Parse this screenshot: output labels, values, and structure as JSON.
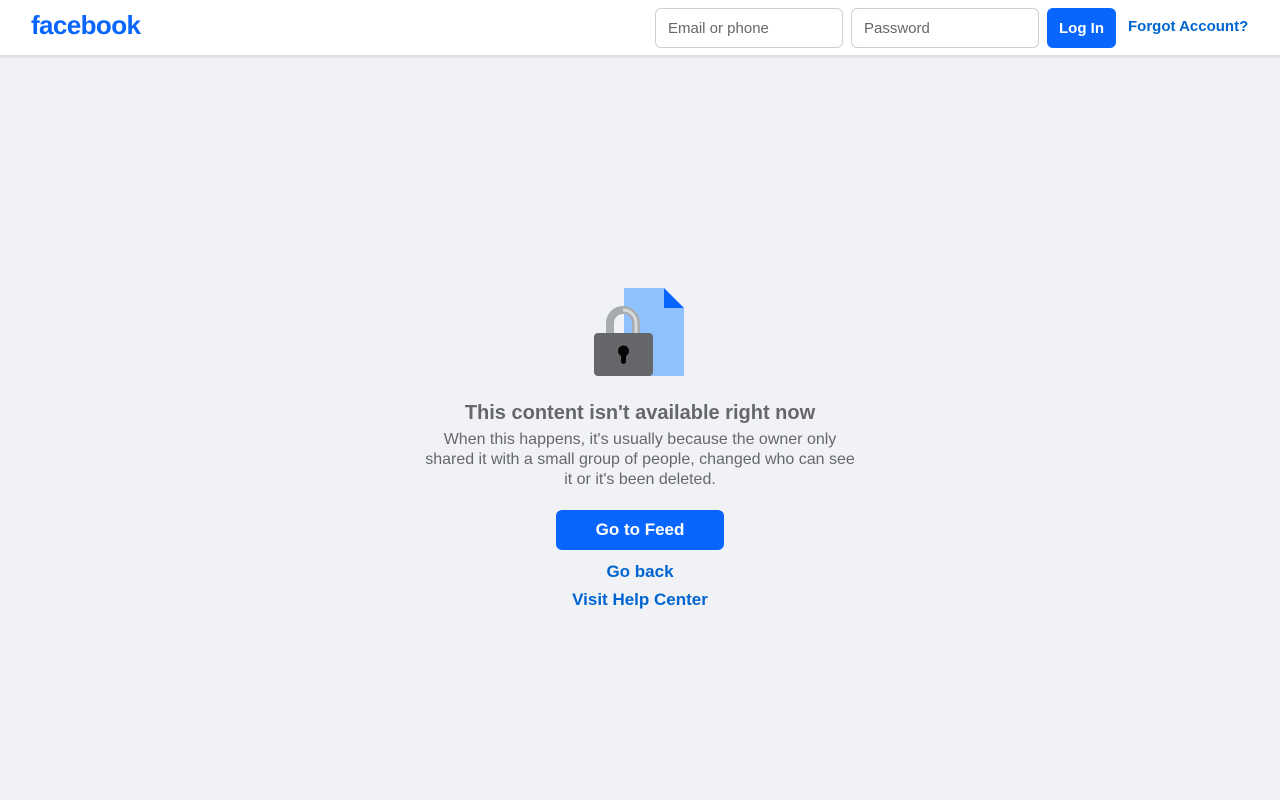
{
  "header": {
    "logo_text": "facebook",
    "email_placeholder": "Email or phone",
    "password_placeholder": "Password",
    "login_label": "Log In",
    "forgot_label": "Forgot Account?"
  },
  "main": {
    "illustration_icon": "locked-document-icon",
    "headline": "This content isn't available right now",
    "description": "When this happens, it's usually because the owner only shared it with a small group of people, changed who can see it or it's been deleted.",
    "feed_button_label": "Go to Feed",
    "go_back_label": "Go back",
    "help_center_label": "Visit Help Center"
  },
  "colors": {
    "brand_blue": "#0866ff",
    "link_blue": "#0064d1",
    "background": "#f0f2f5",
    "muted_text": "#65676b"
  }
}
